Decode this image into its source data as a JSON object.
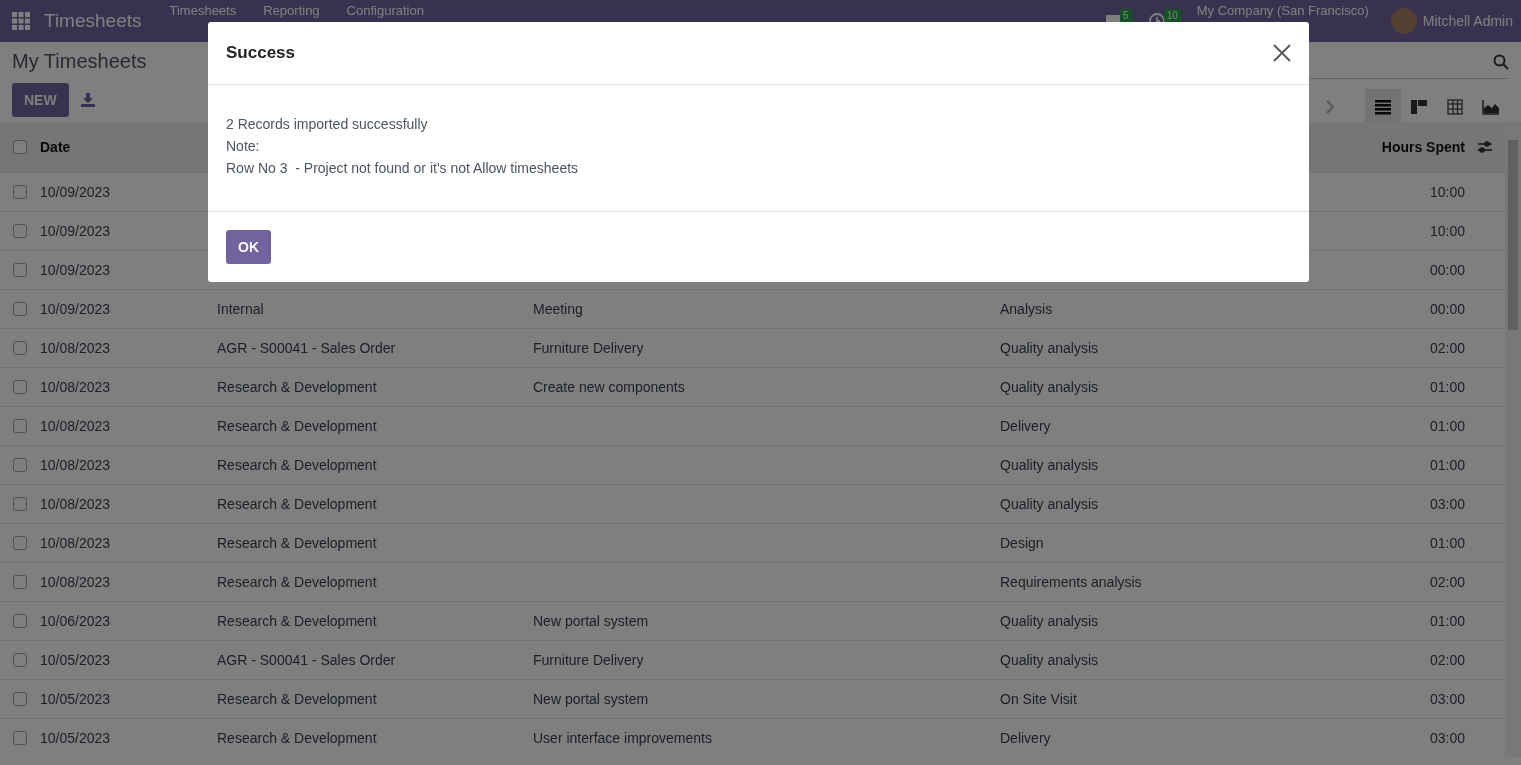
{
  "navbar": {
    "app_name": "Timesheets",
    "menus": [
      "Timesheets",
      "Reporting",
      "Configuration"
    ],
    "messages_badge": "5",
    "activities_badge": "10",
    "company": "My Company (San Francisco)",
    "user": "Mitchell Admin"
  },
  "control_panel": {
    "title": "My Timesheets",
    "new_button": "NEW",
    "views": [
      {
        "kind": "list",
        "selected": true
      },
      {
        "kind": "kanban",
        "selected": false
      },
      {
        "kind": "pivot",
        "selected": false
      },
      {
        "kind": "graph",
        "selected": false
      }
    ]
  },
  "table": {
    "header_checked": false,
    "columns": [
      "Date",
      "Hours Spent"
    ],
    "rows": [
      {
        "checked": false,
        "date": "10/09/2023",
        "hours": "10:00"
      },
      {
        "checked": false,
        "date": "10/09/2023",
        "hours": "10:00"
      },
      {
        "checked": false,
        "date": "10/09/2023",
        "hours": "00:00"
      },
      {
        "checked": false,
        "date": "10/09/2023",
        "column_2": "Internal",
        "column_3": "Meeting",
        "column_4": "Analysis",
        "hours": "00:00"
      },
      {
        "checked": false,
        "date": "10/08/2023",
        "column_2": "AGR - S00041 - Sales Order",
        "column_3": "Furniture Delivery",
        "column_4": "Quality analysis",
        "hours": "02:00"
      },
      {
        "checked": false,
        "date": "10/08/2023",
        "column_2": "Research & Development",
        "column_3": "Create new components",
        "column_4": "Quality analysis",
        "hours": "01:00"
      },
      {
        "checked": false,
        "date": "10/08/2023",
        "column_2": "Research & Development",
        "column_4": "Delivery",
        "hours": "01:00"
      },
      {
        "checked": false,
        "date": "10/08/2023",
        "column_2": "Research & Development",
        "column_4": "Quality analysis",
        "hours": "01:00"
      },
      {
        "checked": false,
        "date": "10/08/2023",
        "column_2": "Research & Development",
        "column_4": "Quality analysis",
        "hours": "03:00"
      },
      {
        "checked": false,
        "date": "10/08/2023",
        "column_2": "Research & Development",
        "column_4": "Design",
        "hours": "01:00"
      },
      {
        "checked": false,
        "date": "10/08/2023",
        "column_2": "Research & Development",
        "column_4": "Requirements analysis",
        "hours": "02:00"
      },
      {
        "checked": false,
        "date": "10/06/2023",
        "column_2": "Research & Development",
        "column_3": "New portal system",
        "column_4": "Quality analysis",
        "hours": "01:00"
      },
      {
        "checked": false,
        "date": "10/05/2023",
        "column_2": "AGR - S00041 - Sales Order",
        "column_3": "Furniture Delivery",
        "column_4": "Quality analysis",
        "hours": "02:00"
      },
      {
        "checked": false,
        "date": "10/05/2023",
        "column_2": "Research & Development",
        "column_3": "New portal system",
        "column_4": "On Site Visit",
        "hours": "03:00"
      },
      {
        "checked": false,
        "date": "10/05/2023",
        "column_2": "Research & Development",
        "column_3": "User interface improvements",
        "column_4": "Delivery",
        "hours": "03:00"
      }
    ]
  },
  "dialog": {
    "title": "Success",
    "lines": [
      "2 Records imported successfully",
      "Note:",
      "Row No 3  - Project not found or it's not Allow timesheets"
    ],
    "ok_button": "OK"
  }
}
